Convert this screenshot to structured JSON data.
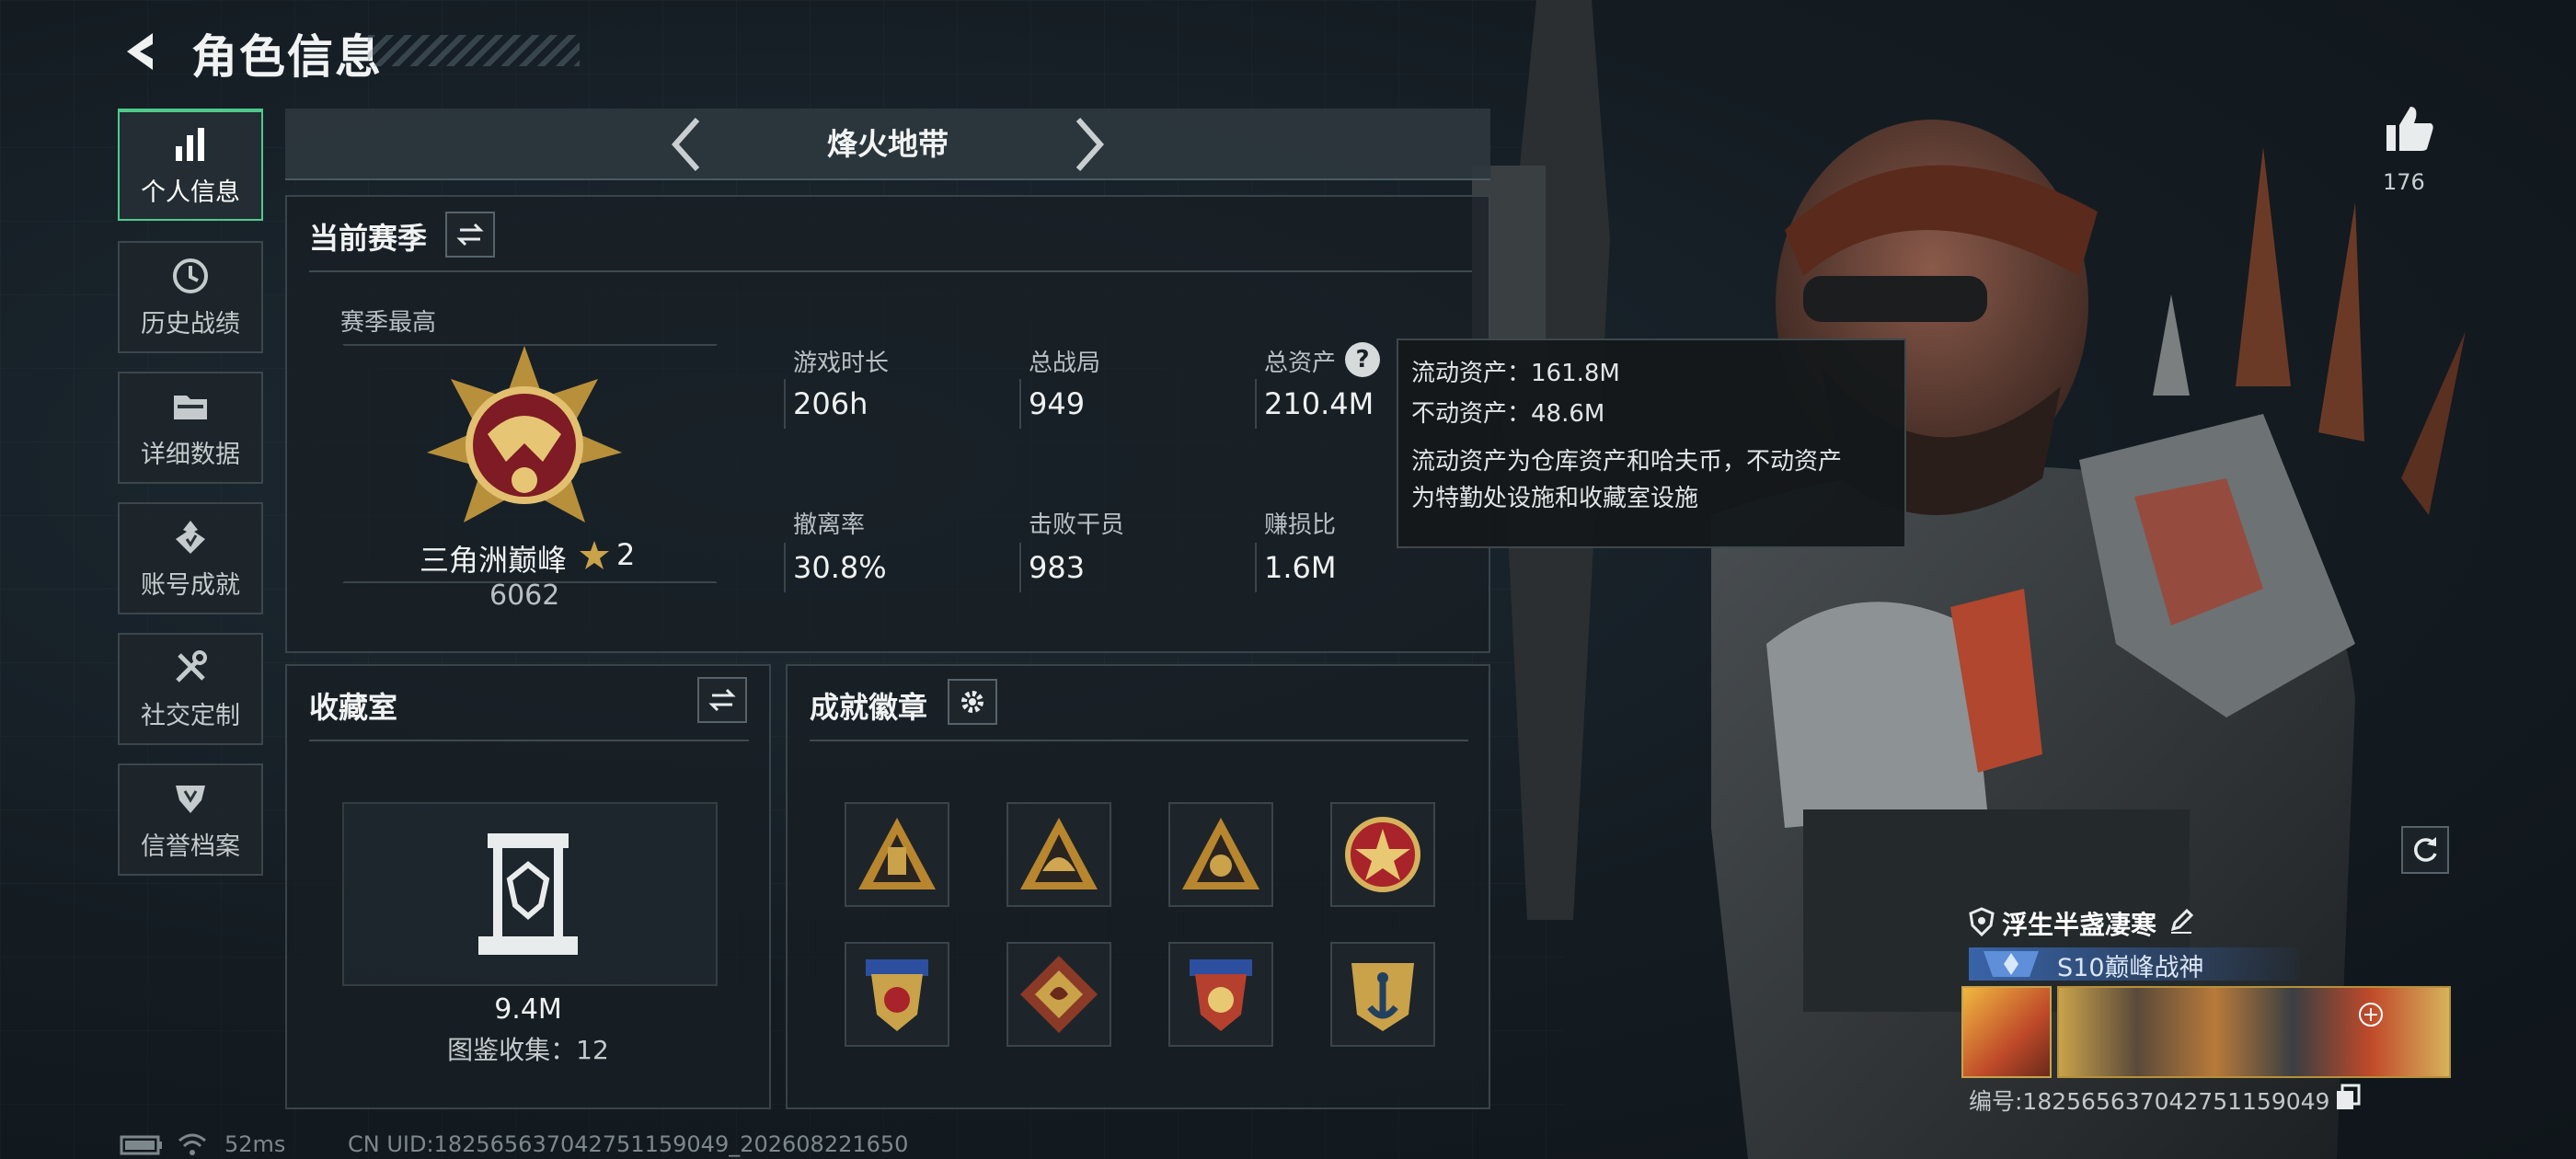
{
  "header": {
    "title": "角色信息"
  },
  "sidebar": {
    "items": [
      {
        "label": "个人信息",
        "icon": "bar-chart-icon",
        "active": true
      },
      {
        "label": "历史战绩",
        "icon": "clock-icon",
        "active": false
      },
      {
        "label": "详细数据",
        "icon": "folder-icon",
        "active": false
      },
      {
        "label": "账号成就",
        "icon": "achievement-icon",
        "active": false
      },
      {
        "label": "社交定制",
        "icon": "tools-icon",
        "active": false
      },
      {
        "label": "信誉档案",
        "icon": "shield-icon",
        "active": false
      }
    ]
  },
  "mode": {
    "title": "烽火地带"
  },
  "season": {
    "title": "当前赛季",
    "best_label": "赛季最高",
    "rank_name": "三角洲巅峰",
    "rank_stars": "2",
    "rank_score": "6062",
    "stats": [
      {
        "label": "游戏时长",
        "value": "206h"
      },
      {
        "label": "总战局",
        "value": "949"
      },
      {
        "label": "总资产",
        "value": "210.4M"
      },
      {
        "label": "撤离率",
        "value": "30.8%"
      },
      {
        "label": "击败干员",
        "value": "983"
      },
      {
        "label": "赚损比",
        "value": "1.6M"
      }
    ]
  },
  "tooltip": {
    "liquid": "流动资产：161.8M",
    "fixed": "不动资产：48.6M",
    "desc_line1": "流动资产为仓库资产和哈夫币，不动资产",
    "desc_line2": "为特勤处设施和收藏室设施"
  },
  "collection": {
    "title": "收藏室",
    "value": "9.4M",
    "count_text": "图鉴收集：12"
  },
  "badges": {
    "title": "成就徽章",
    "items": [
      "badge-1",
      "badge-2",
      "badge-3",
      "badge-4",
      "badge-5",
      "badge-6",
      "badge-7",
      "badge-8"
    ]
  },
  "profile": {
    "likes": "176",
    "name": "浮生半盏凄寒",
    "title": "S10巅峰战神",
    "id": "编号:182565637042751159049"
  },
  "footer": {
    "ping": "52ms",
    "uid": "CN UID:182565637042751159049_202608221650"
  },
  "colors": {
    "accent": "#50c98d",
    "gold": "#c9a24a",
    "panel_border": "#39444a"
  }
}
